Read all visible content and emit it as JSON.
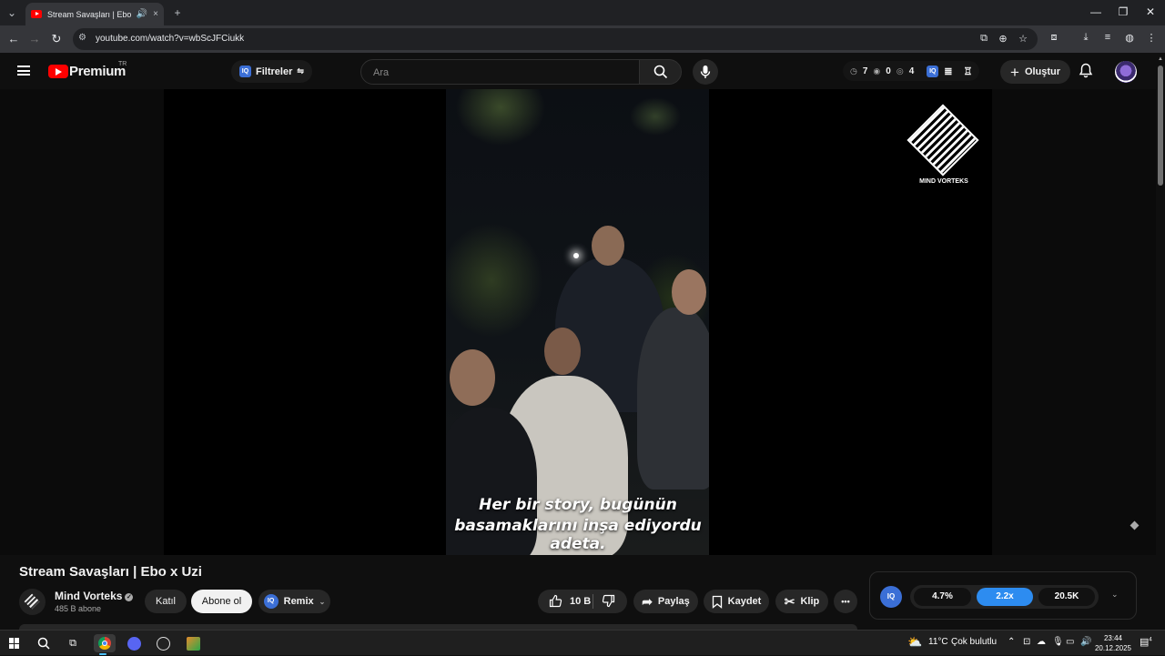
{
  "browser": {
    "tab_title": "Stream Savaşları | Ebo x Uzi",
    "url": "youtube.com/watch?v=wbScJFCiukk",
    "new_tab": "+",
    "tab_close": "×",
    "minimize": "—",
    "restore": "❐",
    "close": "✕"
  },
  "header": {
    "brand": "Premium",
    "region": "TR",
    "filters_label": "Filtreler",
    "search_placeholder": "Ara",
    "stats": {
      "history": "7",
      "eye_a": "0",
      "eye_b": "4"
    },
    "create_label": "Oluştur"
  },
  "video": {
    "subtitle_line1": "Her bir story, bugünün",
    "subtitle_line2": "basamaklarını inşa ediyordu adeta.",
    "watermark": "MIND VORTEKS"
  },
  "info": {
    "title": "Stream Savaşları | Ebo x Uzi",
    "channel": "Mind Vorteks",
    "subscribers": "485 B abone",
    "join_label": "Katıl",
    "subscribe_label": "Abone ol",
    "remix_label": "Remix",
    "likes": "10 B",
    "share_label": "Paylaş",
    "save_label": "Kaydet",
    "clip_label": "Klip",
    "more_label": "•••"
  },
  "widget": {
    "logo": "IQ",
    "values": [
      "4.7%",
      "2.2x",
      "20.5K"
    ],
    "active_color": "#2d8cf0"
  },
  "taskbar": {
    "temperature": "11°C",
    "weather": "Çok bulutlu",
    "time": "23:44",
    "date": "20.12.2025",
    "notifications": "4"
  },
  "colors": {
    "youtube_red": "#ff0000",
    "iq_blue": "#3b6fd6",
    "background": "#0f0f0f"
  }
}
